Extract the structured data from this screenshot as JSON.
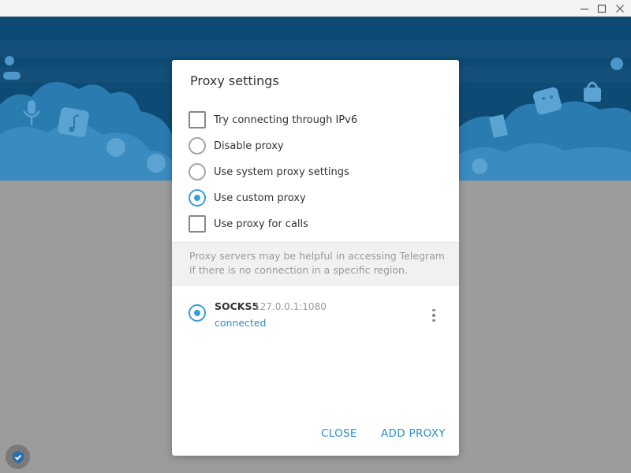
{
  "window_controls": {
    "minimize_icon": "minimize-icon",
    "maximize_icon": "maximize-icon",
    "close_icon": "close-icon"
  },
  "colors": {
    "header": "#0e4b74",
    "accent": "#3a9fd9",
    "link": "#2a8fc9",
    "overlay": "#9c9c9c"
  },
  "dialog": {
    "title": "Proxy settings",
    "options": [
      {
        "type": "checkbox",
        "label": "Try connecting through IPv6",
        "checked": false
      },
      {
        "type": "radio",
        "label": "Disable proxy",
        "checked": false
      },
      {
        "type": "radio",
        "label": "Use system proxy settings",
        "checked": false
      },
      {
        "type": "radio",
        "label": "Use custom proxy",
        "checked": true
      },
      {
        "type": "checkbox",
        "label": "Use proxy for calls",
        "checked": false
      }
    ],
    "about": "Proxy servers may be helpful in accessing Telegram if there is no connection in a specific region.",
    "proxy": {
      "type": "SOCKS5",
      "address": "127.0.0.1:1080",
      "status": "connected",
      "selected": true
    },
    "buttons": {
      "close": "CLOSE",
      "add": "ADD PROXY"
    }
  }
}
